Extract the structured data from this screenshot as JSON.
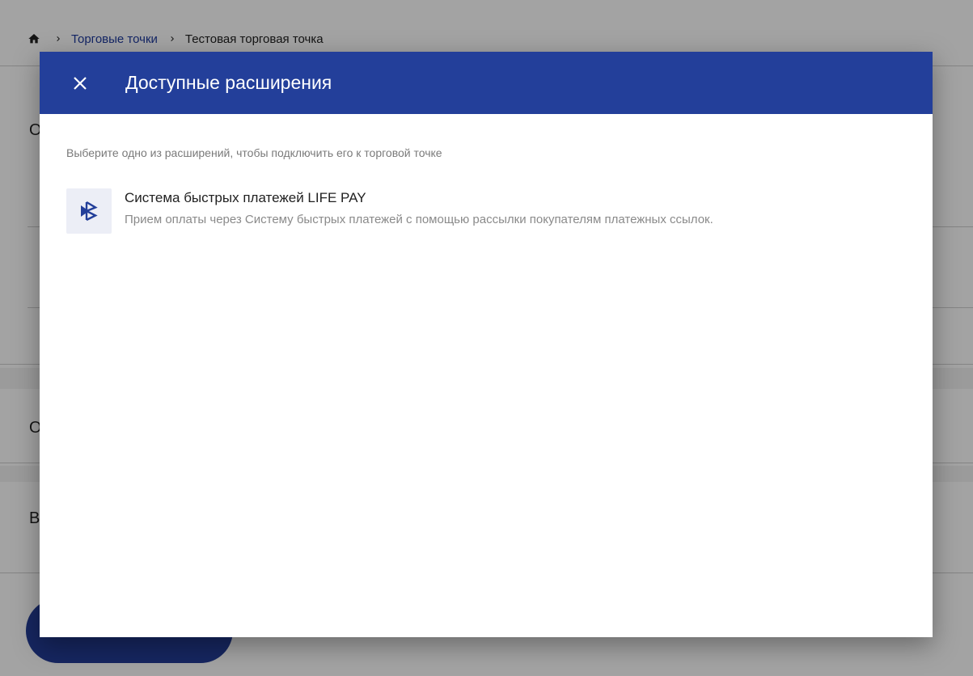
{
  "breadcrumb": {
    "home_icon": "home-icon",
    "items": [
      "Торговые точки",
      "Тестовая торговая точка"
    ]
  },
  "background": {
    "section_letters": [
      "О",
      "О",
      "В"
    ]
  },
  "dialog": {
    "title": "Доступные расширения",
    "close_icon": "close-icon",
    "hint": "Выберите одно из расширений, чтобы подключить его к торговой точке",
    "extensions": [
      {
        "icon": "sbp-logo-icon",
        "title": "Система быстрых платежей LIFE PAY",
        "description": "Прием оплаты через Систему быстрых платежей с помощью рассылки покупателям платежных ссылок."
      }
    ]
  },
  "colors": {
    "header": "#233f9a",
    "link": "#1f3a9e",
    "icon_bg": "#eceef6"
  }
}
